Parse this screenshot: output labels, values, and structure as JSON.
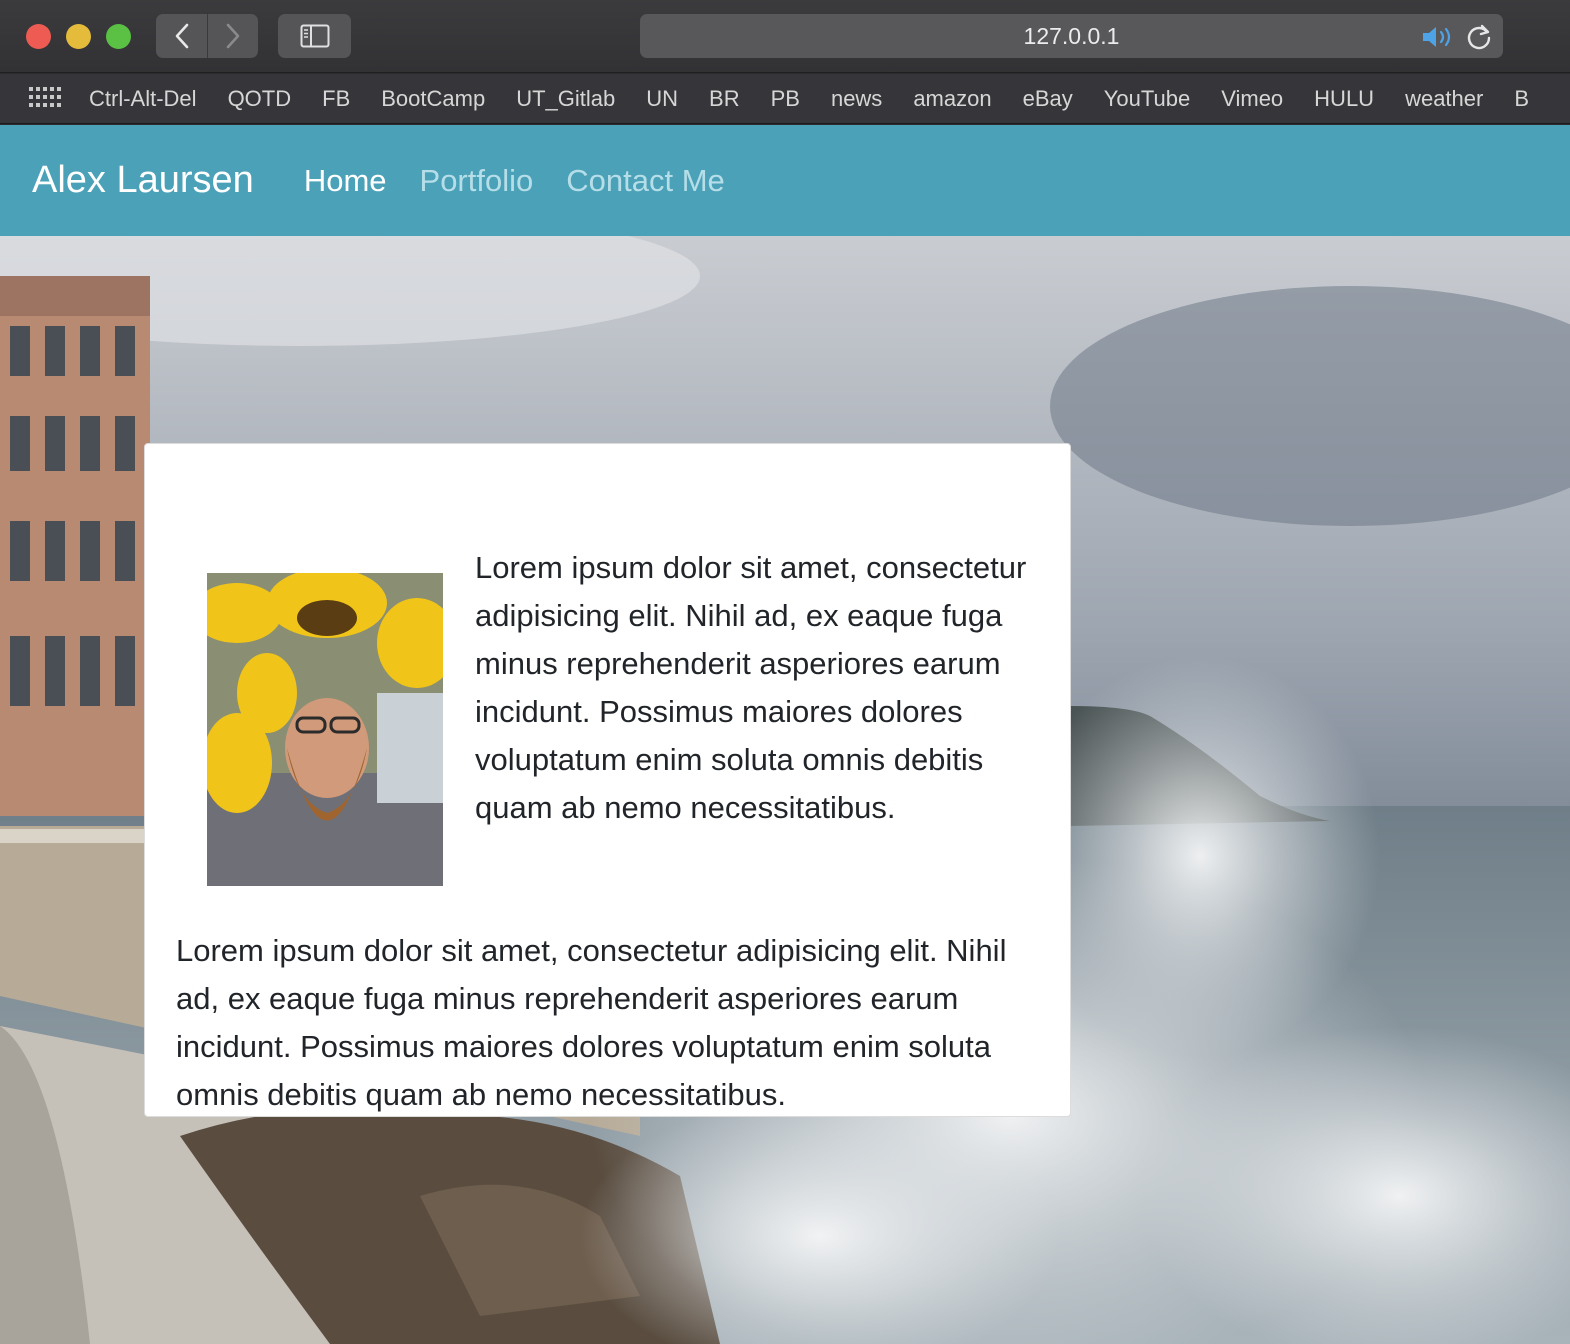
{
  "browser": {
    "url": "127.0.0.1",
    "bookmarks": [
      "Ctrl-Alt-Del",
      "QOTD",
      "FB",
      "BootCamp",
      "UT_Gitlab",
      "UN",
      "BR",
      "PB",
      "news",
      "amazon",
      "eBay",
      "YouTube",
      "Vimeo",
      "HULU",
      "weather",
      "B"
    ]
  },
  "site": {
    "brand": "Alex Laursen",
    "nav": {
      "home": "Home",
      "portfolio": "Portfolio",
      "contact": "Contact Me"
    },
    "colors": {
      "navbar": "#4aa1b8",
      "active_link": "#ffffff",
      "inactive_link": "#b6dee8"
    }
  },
  "card": {
    "paragraph_1": "Lorem ipsum dolor sit amet, consectetur adipisicing elit. Nihil ad, ex eaque fuga minus reprehenderit asperiores earum incidunt. Possimus maiores dolores voluptatum enim soluta omnis debitis quam ab nemo necessitatibus.",
    "paragraph_2": "Lorem ipsum dolor sit amet, consectetur adipisicing elit. Nihil ad, ex eaque fuga minus reprehenderit asperiores earum incidunt. Possimus maiores dolores voluptatum enim soluta omnis debitis quam ab nemo necessitatibus."
  },
  "icons": [
    "back-icon",
    "forward-icon",
    "sidebar-icon",
    "speaker-icon",
    "reload-icon",
    "apps-grid-icon"
  ]
}
